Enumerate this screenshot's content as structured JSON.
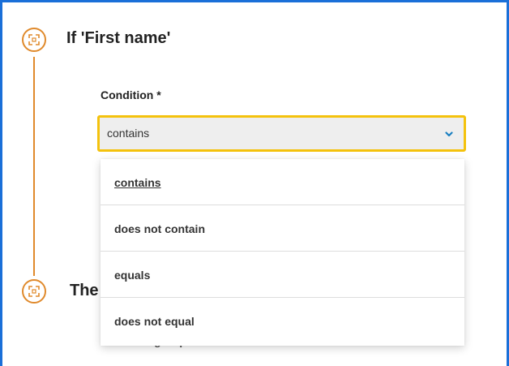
{
  "steps": [
    {
      "title": "If 'First name'",
      "icon": "scan-icon"
    },
    {
      "title": "The",
      "icon": "scan-icon"
    }
  ],
  "condition": {
    "label": "Condition *",
    "value": "contains",
    "options": [
      {
        "label": "contains",
        "selected": true
      },
      {
        "label": "does not contain",
        "selected": false
      },
      {
        "label": "equals",
        "selected": false
      },
      {
        "label": "does not equal",
        "selected": false
      }
    ]
  },
  "elements_group": {
    "label": "Elements group *"
  },
  "colors": {
    "accent_orange": "#e08a2c",
    "focus_yellow": "#f4c20d",
    "frame_blue": "#1a6fd8",
    "chevron_blue": "#1a7fc1"
  }
}
